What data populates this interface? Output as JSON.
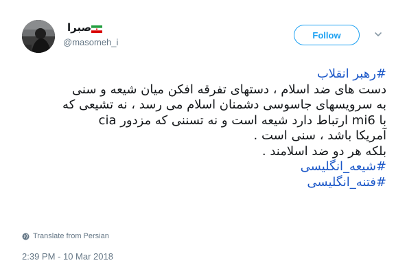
{
  "author": {
    "display_name": "صبرا",
    "handle": "@masomeh_i",
    "flag_icon": "iran-flag-icon"
  },
  "follow_button": {
    "label": "Follow"
  },
  "menu_icon": "chevron-down-icon",
  "tweet": {
    "hashtag_top": "#رهبر انقلاب",
    "lines": [
      "دست های ضد اسلام ، دستهای تفرقه افکن میان شیعه و سنی",
      "به سرویسهای جاسوسی دشمنان اسلام می رسد ، نه تشیعی که",
      "با mi6 ارتباط دارد شیعه است و نه تسننی که مزدور cia",
      "آمریکا باشد ، سنی است .",
      "بلکه هر دو ضد اسلامند ."
    ],
    "hashtag_1": "#شیعه_انگلیسی",
    "hashtag_2": "#فتنه_انگلیسی"
  },
  "translate": {
    "label": "Translate from Persian",
    "icon": "globe-icon"
  },
  "timestamp": "2:39 PM - 10 Mar 2018",
  "colors": {
    "link": "#1b57c8",
    "follow": "#1da1f2",
    "muted": "#657786",
    "text": "#14171a"
  }
}
